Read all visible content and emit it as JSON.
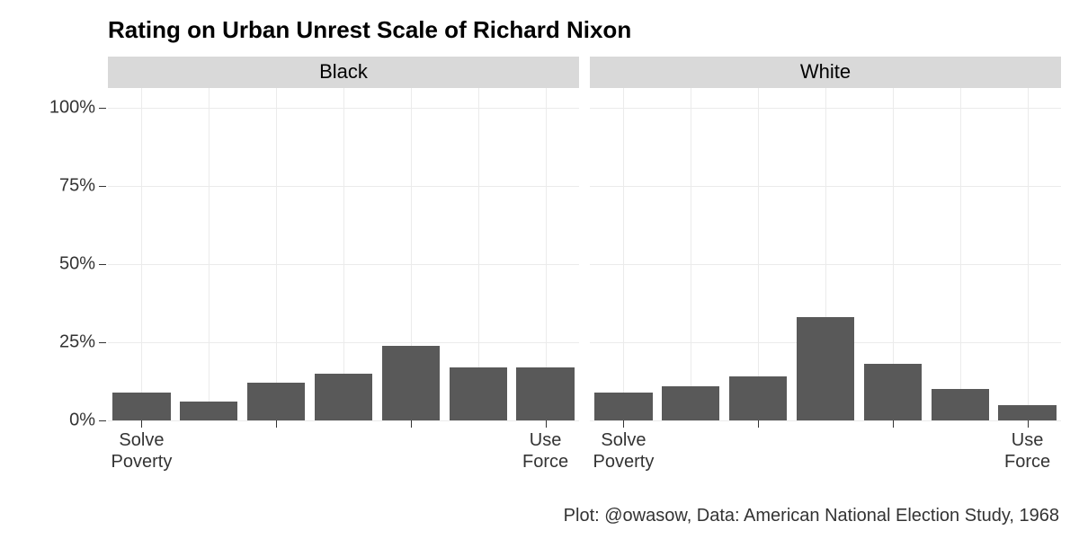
{
  "title": "Rating on Urban Unrest Scale of Richard Nixon",
  "caption": "Plot: @owasow, Data: American National Election Study, 1968",
  "y_ticks": [
    0,
    25,
    50,
    75,
    100
  ],
  "y_tick_labels": [
    "0%",
    "25%",
    "50%",
    "75%",
    "100%"
  ],
  "y_top_pad_frac": 0.06,
  "x_categories": [
    1,
    2,
    3,
    4,
    5,
    6,
    7
  ],
  "x_tick_positions": [
    1,
    3,
    5,
    7
  ],
  "x_tick_labels": [
    "Solve\nPoverty",
    "",
    "",
    "Use\nForce"
  ],
  "bar_width_frac": 0.86,
  "facets": [
    {
      "label": "Black",
      "show_y_axis": true
    },
    {
      "label": "White",
      "show_y_axis": false
    }
  ],
  "chart_data": {
    "type": "bar",
    "title": "Rating on Urban Unrest Scale of Richard Nixon",
    "xlabel": "",
    "ylabel": "",
    "ylim": [
      0,
      100
    ],
    "x_scale_labels": {
      "1": "Solve Poverty",
      "7": "Use Force"
    },
    "categories": [
      1,
      2,
      3,
      4,
      5,
      6,
      7
    ],
    "series": [
      {
        "name": "Black",
        "values": [
          9,
          6,
          12,
          15,
          24,
          17,
          17
        ]
      },
      {
        "name": "White",
        "values": [
          9,
          11,
          14,
          33,
          18,
          10,
          5
        ]
      }
    ],
    "y_unit": "%"
  }
}
